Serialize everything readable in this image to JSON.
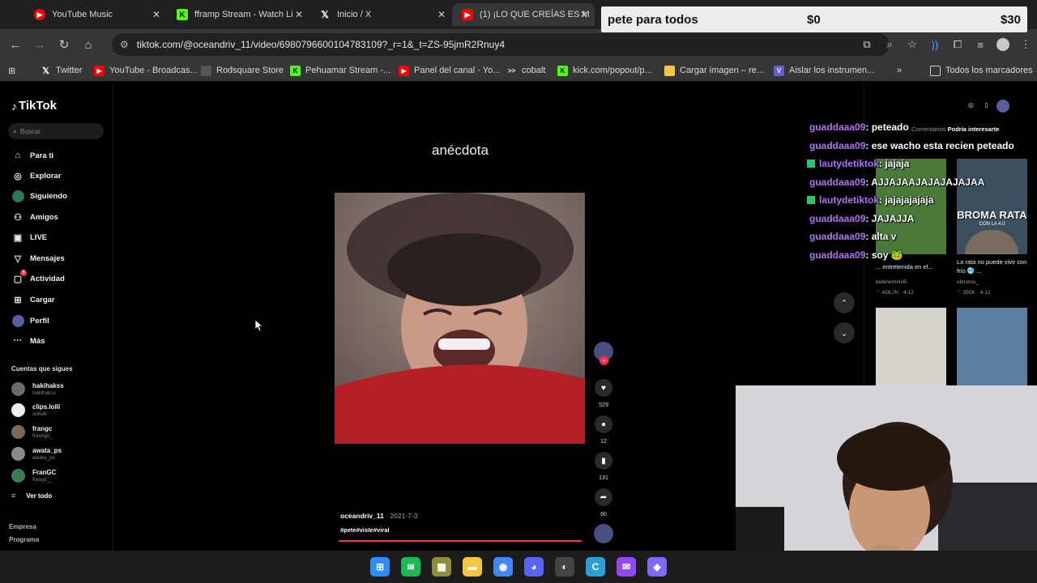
{
  "browser": {
    "tabs": [
      {
        "title": "YouTube Music",
        "icon": "youtube-music-icon",
        "color": "#ff0000",
        "active": false
      },
      {
        "title": "fframp Stream - Watch Li",
        "icon": "kick-icon",
        "color": "#53fc18",
        "active": false
      },
      {
        "title": "Inicio / X",
        "icon": "x-icon",
        "color": "#ffffff",
        "active": false
      },
      {
        "title": "(1) ¡LO QUE CREÍAS ES M",
        "icon": "youtube-icon",
        "color": "#ff0000",
        "active": true
      }
    ],
    "url": "tiktok.com/@oceandriv_11/video/6980796600104783109?_r=1&_t=ZS-95jmR2Rnuy4",
    "bookmarks": [
      {
        "label": "Twitter",
        "icon": "x-icon",
        "color": "#ffffff"
      },
      {
        "label": "YouTube - Broadcas...",
        "icon": "youtube-icon",
        "color": "#ff0000"
      },
      {
        "label": "Rodsquare Store",
        "icon": "store-icon",
        "color": "#444444"
      },
      {
        "label": "Pehuamar Stream -...",
        "icon": "kick-icon",
        "color": "#53fc18"
      },
      {
        "label": "Panel del canal - Yo...",
        "icon": "youtube-icon",
        "color": "#ff0000"
      },
      {
        "label": "cobalt",
        "icon": "cobalt-icon",
        "color": "#ffffff"
      },
      {
        "label": "kick.com/popout/p...",
        "icon": "kick-icon",
        "color": "#53fc18"
      },
      {
        "label": "Cargar imagen – re...",
        "icon": "image-upload-icon",
        "color": "#f4c542"
      },
      {
        "label": "Aislar los instrumen...",
        "icon": "vocal-remover-icon",
        "color": "#6b5bd6"
      }
    ],
    "all_bookmarks_label": "Todos los marcadores"
  },
  "donation": {
    "title": "pete para todos",
    "current": "$0",
    "goal": "$30"
  },
  "tiktok": {
    "logo_text": "TikTok",
    "search_placeholder": "Buscar",
    "nav": [
      {
        "label": "Para ti",
        "icon": "home-icon"
      },
      {
        "label": "Explorar",
        "icon": "compass-icon"
      },
      {
        "label": "Siguiendo",
        "icon": "following-icon"
      },
      {
        "label": "Amigos",
        "icon": "friends-icon"
      },
      {
        "label": "LIVE",
        "icon": "live-icon"
      },
      {
        "label": "Mensajes",
        "icon": "messages-icon"
      },
      {
        "label": "Actividad",
        "icon": "activity-icon",
        "badge": "5"
      },
      {
        "label": "Cargar",
        "icon": "upload-icon"
      },
      {
        "label": "Perfil",
        "icon": "profile-icon"
      },
      {
        "label": "Más",
        "icon": "more-icon"
      }
    ],
    "following_header": "Cuentas que sigues",
    "following": [
      {
        "name": "hakihakss",
        "handle": "hakihakss"
      },
      {
        "name": "clips.lolli",
        "handle": "soilolli"
      },
      {
        "name": "frangc",
        "handle": "franngc_"
      },
      {
        "name": "awata_ps",
        "handle": "awata_ps"
      },
      {
        "name": "FranGC",
        "handle": "frangc__"
      }
    ],
    "see_all": "Ver todo",
    "footer": [
      "Empresa",
      "Programa"
    ],
    "video_title": "anécdota",
    "author": "oceandriv_11",
    "date": "· 2021-7-3",
    "hashtags": "#pete#viste#viral",
    "actions": [
      {
        "icon": "heart-icon",
        "count": "529"
      },
      {
        "icon": "comment-icon",
        "count": "12"
      },
      {
        "icon": "bookmark-icon",
        "count": "131"
      },
      {
        "icon": "share-icon",
        "count": "60"
      }
    ],
    "right_panel": {
      "tab_comments": "Comentarios",
      "tab_suggestions": "Podría interesarte",
      "thumbs": [
        {
          "caption": "... entretenida en el...",
          "user": "belenerminil5",
          "likes": "♡ 428.7K · 4-12"
        },
        {
          "caption": "La rata no puede vivir con frío 🥶 ...",
          "user": "elmuruu_",
          "likes": "♡ 355K · 4-12"
        }
      ],
      "thumb_texts": [
        "BROMA RATA",
        "CON LA 4.0"
      ]
    }
  },
  "chat": [
    {
      "user": "guaddaaa09",
      "msg": ": peteado",
      "badge": false
    },
    {
      "user": "guaddaaa09",
      "msg": ": ese wacho esta recien peteado",
      "badge": false
    },
    {
      "user": "lautydetiktok",
      "msg": ": jajaja",
      "badge": true
    },
    {
      "user": "guaddaaa09",
      "msg": ": AJJAJAAJAJAJAJAJAA",
      "badge": false
    },
    {
      "user": "lautydetiktok",
      "msg": ": jajajajajaja",
      "badge": true
    },
    {
      "user": "guaddaaa09",
      "msg": ": JAJAJJA",
      "badge": false
    },
    {
      "user": "guaddaaa09",
      "msg": ": alta v",
      "badge": false
    },
    {
      "user": "guaddaaa09",
      "msg": ": soy 🐸",
      "badge": false
    }
  ],
  "taskbar": [
    {
      "icon": "windows-start-icon",
      "color": "#2d8cff"
    },
    {
      "icon": "spotify-icon",
      "color": "#1db954"
    },
    {
      "icon": "app-icon",
      "color": "#8f8f3a"
    },
    {
      "icon": "file-explorer-icon",
      "color": "#f4c542"
    },
    {
      "icon": "chrome-icon",
      "color": "#4285f4"
    },
    {
      "icon": "discord-icon",
      "color": "#5865f2"
    },
    {
      "icon": "obs-icon",
      "color": "#444444"
    },
    {
      "icon": "ccleaner-icon",
      "color": "#2aa0d4"
    },
    {
      "icon": "twitch-chat-icon",
      "color": "#9146ff"
    },
    {
      "icon": "streamlabs-icon",
      "color": "#8067ff"
    }
  ]
}
